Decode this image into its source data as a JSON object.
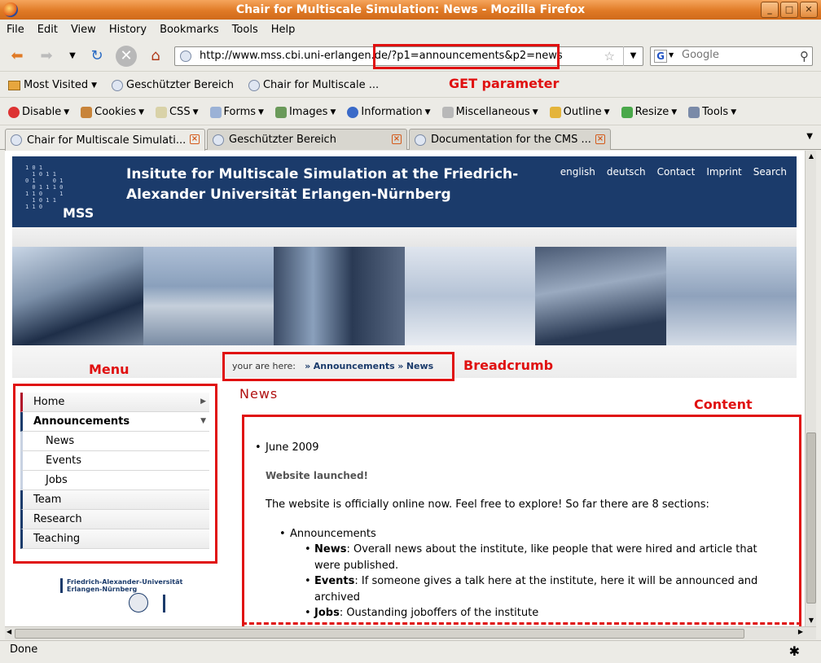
{
  "window": {
    "title": "Chair for Multiscale Simulation: News - Mozilla Firefox"
  },
  "menubar": [
    "File",
    "Edit",
    "View",
    "History",
    "Bookmarks",
    "Tools",
    "Help"
  ],
  "navbar": {
    "url": "http://www.mss.cbi.uni-erlangen.de/?p1=announcements&p2=news",
    "search_placeholder": "Google"
  },
  "bookmarks": [
    "Most Visited",
    "Geschützter Bereich",
    "Chair for Multiscale ..."
  ],
  "devbar": [
    "Disable",
    "Cookies",
    "CSS",
    "Forms",
    "Images",
    "Information",
    "Miscellaneous",
    "Outline",
    "Resize",
    "Tools"
  ],
  "tabs": [
    "Chair for Multiscale Simulati...",
    "Geschützter Bereich",
    "Documentation for the CMS ..."
  ],
  "site": {
    "logo_binary": [
      "1 0 1",
      "  1 0 1 1",
      "0 1     0 1",
      "  0 1 1 1 0",
      "1 1 0     1",
      "  1 0 1 1",
      "1 1 0"
    ],
    "logo_text": "MSS",
    "title_line1": "Insitute for Multiscale Simulation at the Friedrich-",
    "title_line2": "Alexander Universität Erlangen-Nürnberg",
    "top_links": [
      "english",
      "deutsch",
      "Contact",
      "Imprint",
      "Search"
    ]
  },
  "breadcrumb": {
    "prefix": "your are here:",
    "items": [
      "Announcements",
      "News"
    ]
  },
  "menu": {
    "items": [
      {
        "label": "Home"
      },
      {
        "label": "Announcements"
      },
      {
        "label": "News"
      },
      {
        "label": "Events"
      },
      {
        "label": "Jobs"
      },
      {
        "label": "Team"
      },
      {
        "label": "Research"
      },
      {
        "label": "Teaching"
      }
    ]
  },
  "fau_logo": {
    "line1": "Friedrich-Alexander-Universität",
    "line2": "Erlangen-Nürnberg"
  },
  "page_title": "News",
  "content": {
    "date": "June 2009",
    "headline": "Website launched!",
    "intro": "The website is officially online now. Feel free to explore! So far there are 8 sections:",
    "section": "Announcements",
    "sub_items": [
      {
        "term": "News",
        "text": ": Overall news about the institute, like people that were hired and article that were published."
      },
      {
        "term": "Events",
        "text": ": If someone gives a talk here at the institute, here it will be announced and archived"
      },
      {
        "term": "Jobs",
        "text": ": Oustanding joboffers of the institute"
      }
    ]
  },
  "annotations": {
    "get_parameter": "GET parameter",
    "menu": "Menu",
    "breadcrumb": "Breadcrumb",
    "content": "Content",
    "color": "#e01010"
  },
  "status": {
    "text": "Done"
  },
  "colors": {
    "header_blue": "#1b3b6b",
    "accent_red": "#b01010",
    "titlebar_orange": "#e07a26"
  }
}
